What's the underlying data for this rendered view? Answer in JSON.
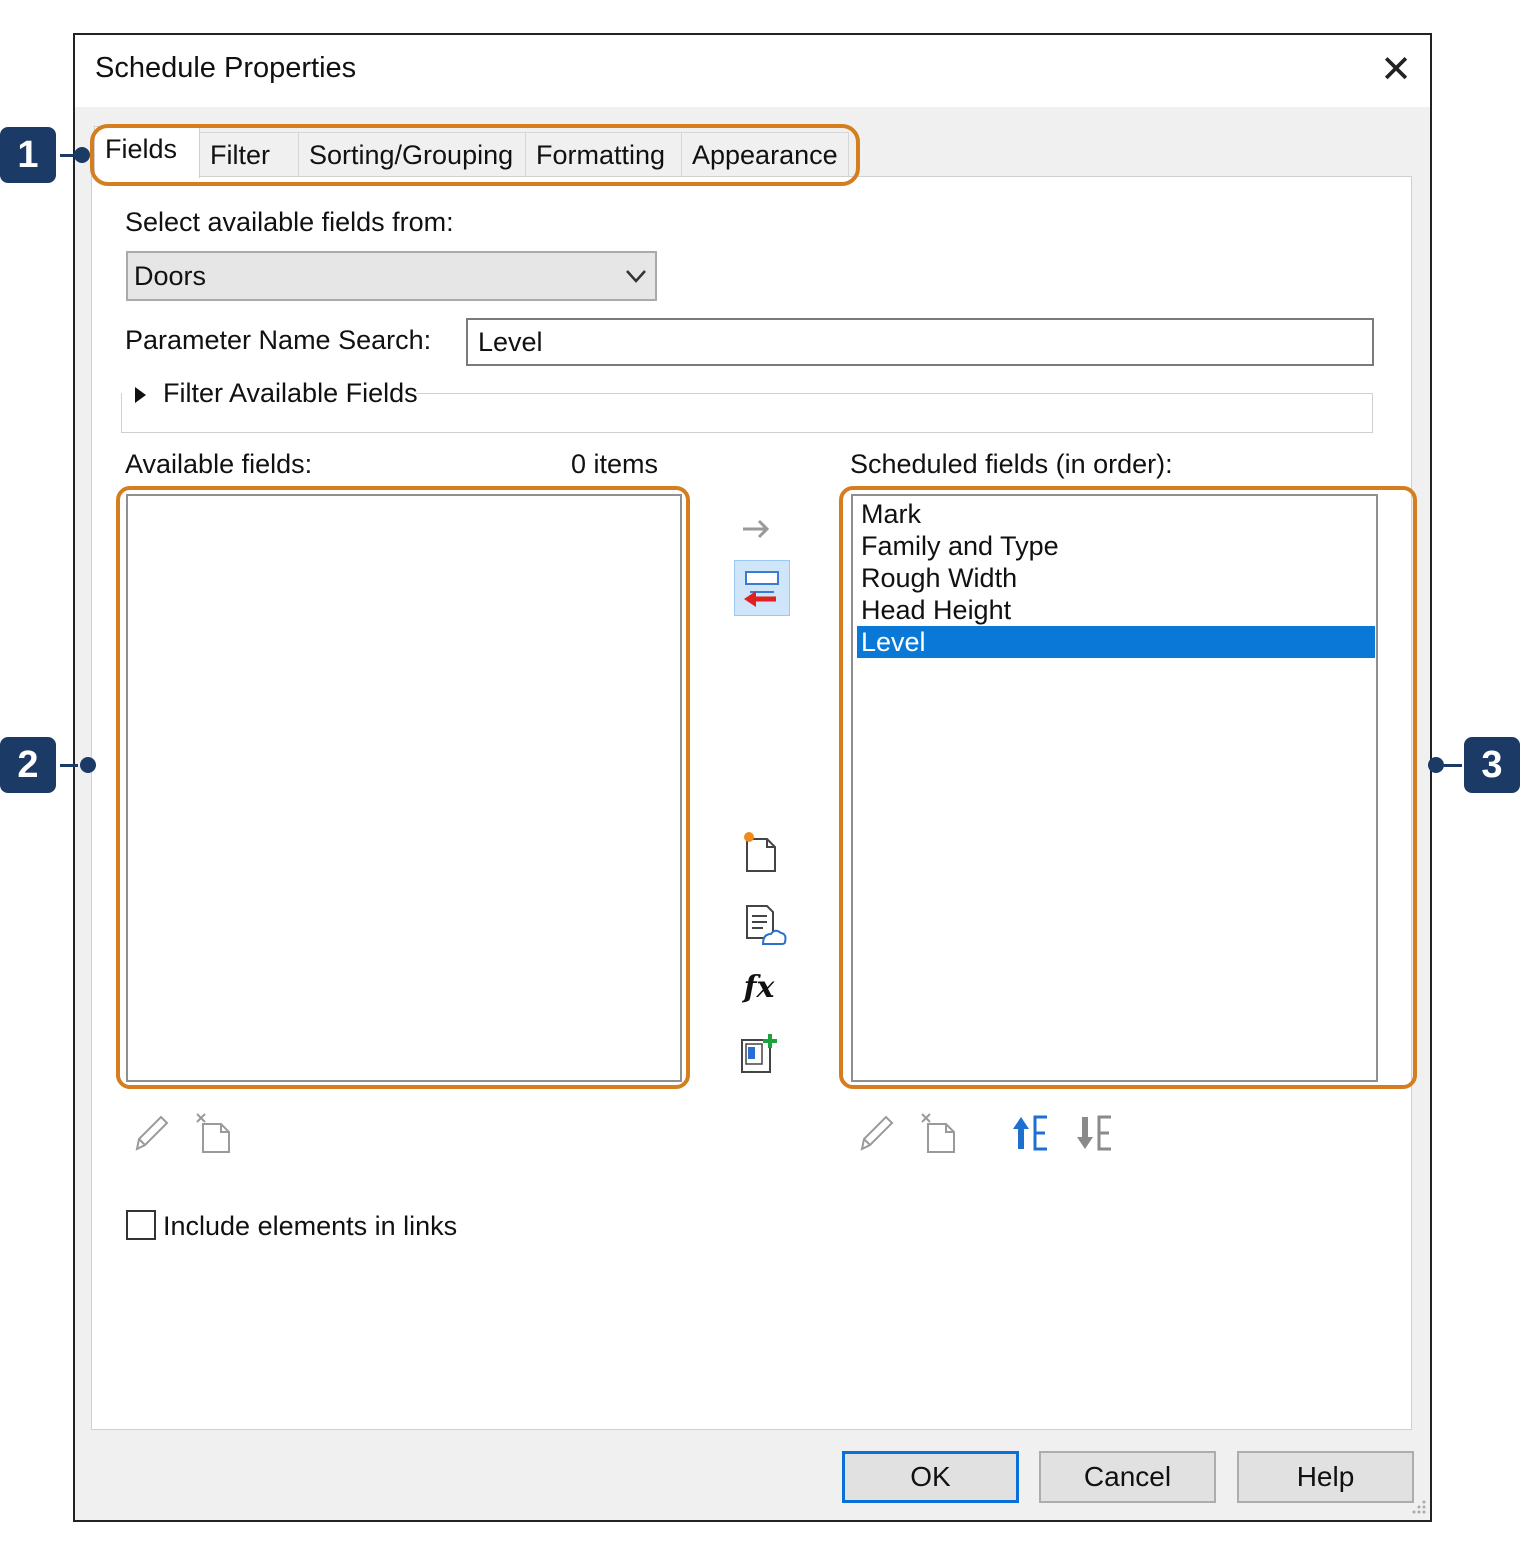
{
  "dialog": {
    "title": "Schedule Properties",
    "close_glyph": "✕"
  },
  "tabs": [
    {
      "label": "Fields",
      "active": true
    },
    {
      "label": "Filter",
      "active": false
    },
    {
      "label": "Sorting/Grouping",
      "active": false
    },
    {
      "label": "Formatting",
      "active": false
    },
    {
      "label": "Appearance",
      "active": false
    }
  ],
  "fields_tab": {
    "select_from_label": "Select available fields from:",
    "select_from_value": "Doors",
    "search_label": "Parameter Name Search:",
    "search_value": "Level",
    "filter_expander_label": "Filter Available Fields",
    "available_label": "Available fields:",
    "available_count": "0 items",
    "available_items": [],
    "scheduled_label": "Scheduled fields (in order):",
    "scheduled_items": [
      "Mark",
      "Family and Type",
      "Rough Width",
      "Head Height",
      "Level"
    ],
    "scheduled_selected": "Level",
    "include_links_label": "Include elements in links",
    "include_links_checked": false,
    "formula_icon_text": "fx"
  },
  "buttons": {
    "ok": "OK",
    "cancel": "Cancel",
    "help": "Help"
  },
  "callouts": [
    "1",
    "2",
    "3"
  ],
  "colors": {
    "highlight_outline": "#d47e1f",
    "callout_badge": "#1c3a66",
    "selection": "#0a78d7"
  }
}
